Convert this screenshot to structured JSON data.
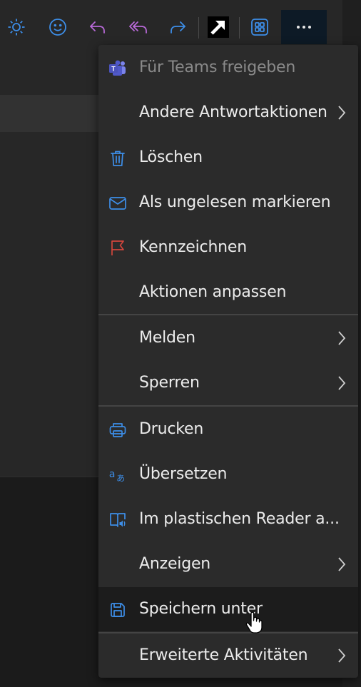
{
  "toolbar": {
    "buttons": [
      {
        "name": "brightness-icon",
        "color": "#3d8ee8"
      },
      {
        "name": "emoji-icon",
        "color": "#3d8ee8"
      },
      {
        "name": "reply-icon",
        "color": "#b96ad9"
      },
      {
        "name": "reply-all-icon",
        "color": "#b96ad9"
      },
      {
        "name": "forward-icon",
        "color": "#3d8ee8"
      },
      {
        "name": "expand-arrow-icon",
        "color": "#ffffff"
      },
      {
        "name": "apps-icon",
        "color": "#3d8ee8"
      },
      {
        "name": "more-options-icon",
        "color": "#e8e8e8"
      }
    ]
  },
  "menu": {
    "items": [
      {
        "label": "Für Teams freigeben",
        "icon": "teams-icon",
        "disabled": true,
        "submenu": false
      },
      {
        "label": "Andere Antwortaktionen",
        "icon": "",
        "disabled": false,
        "submenu": true
      },
      {
        "label": "Löschen",
        "icon": "trash-icon",
        "disabled": false,
        "submenu": false
      },
      {
        "label": "Als ungelesen markieren",
        "icon": "envelope-icon",
        "disabled": false,
        "submenu": false
      },
      {
        "label": "Kennzeichnen",
        "icon": "flag-icon",
        "disabled": false,
        "submenu": false
      },
      {
        "label": "Aktionen anpassen",
        "icon": "",
        "disabled": false,
        "submenu": false
      },
      {
        "label": "Melden",
        "icon": "",
        "disabled": false,
        "submenu": true
      },
      {
        "label": "Sperren",
        "icon": "",
        "disabled": false,
        "submenu": true
      },
      {
        "label": "Drucken",
        "icon": "printer-icon",
        "disabled": false,
        "submenu": false
      },
      {
        "label": "Übersetzen",
        "icon": "translate-icon",
        "disabled": false,
        "submenu": false
      },
      {
        "label": "Im plastischen Reader a...",
        "icon": "immersive-reader-icon",
        "disabled": false,
        "submenu": false
      },
      {
        "label": "Anzeigen",
        "icon": "",
        "disabled": false,
        "submenu": true
      },
      {
        "label": "Speichern unter",
        "icon": "save-icon",
        "disabled": false,
        "submenu": false,
        "hovered": true
      },
      {
        "label": "Erweiterte Aktivitäten",
        "icon": "",
        "disabled": false,
        "submenu": true
      }
    ]
  },
  "colors": {
    "accent_blue": "#3d8ee8",
    "reply_purple": "#b96ad9",
    "flag_red": "#d2463c",
    "menu_bg": "#2b2b2b",
    "hover_bg": "#1c1c1c"
  }
}
